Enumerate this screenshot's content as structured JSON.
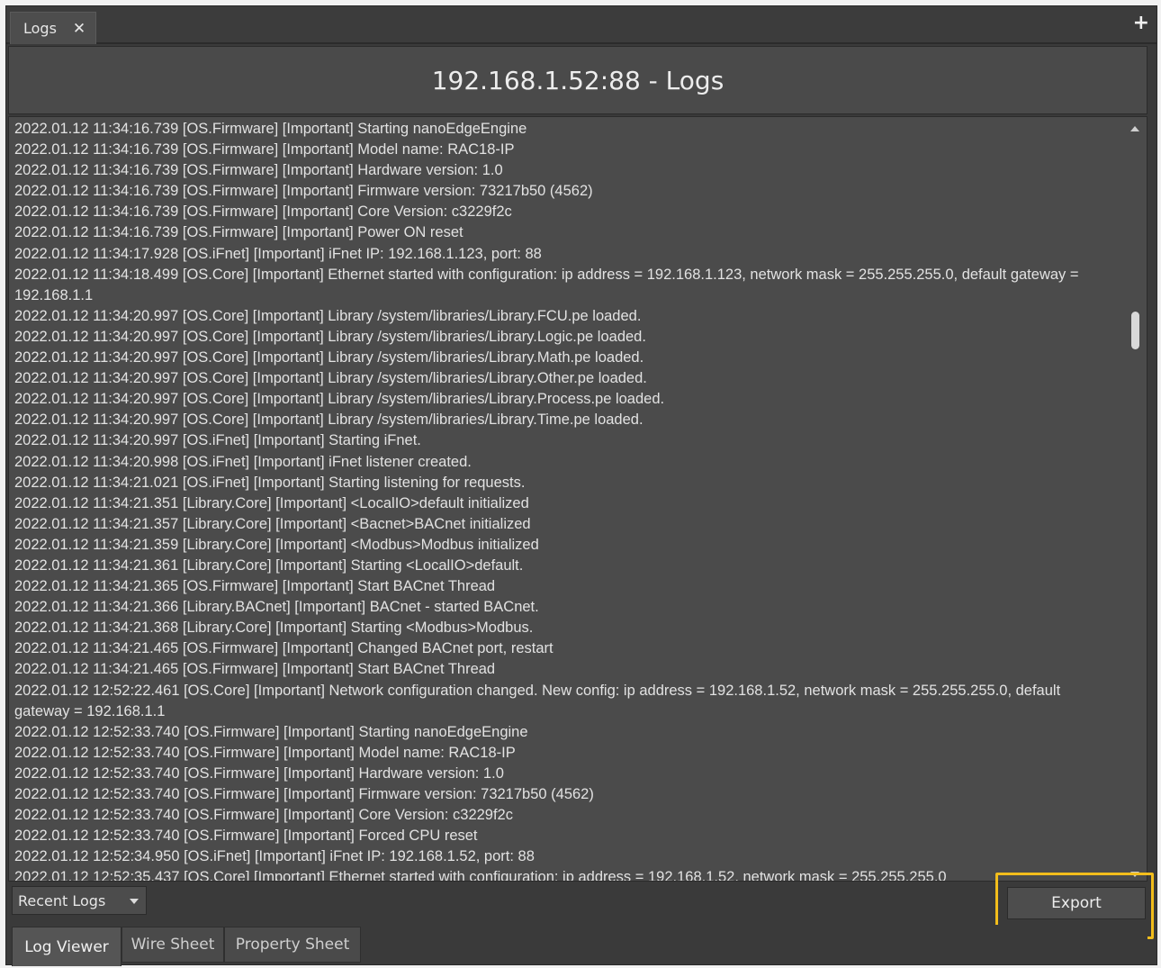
{
  "doc_tab": {
    "label": "Logs",
    "close_icon": "✕"
  },
  "add_tab_icon": "+",
  "header": {
    "title": "192.168.1.52:88 - Logs"
  },
  "log_lines": [
    "2022.01.12 11:34:16.739 [OS.Firmware] [Important] Starting nanoEdgeEngine",
    "2022.01.12 11:34:16.739 [OS.Firmware] [Important] Model name: RAC18-IP",
    "2022.01.12 11:34:16.739 [OS.Firmware] [Important] Hardware version: 1.0",
    "2022.01.12 11:34:16.739 [OS.Firmware] [Important] Firmware version: 73217b50 (4562)",
    "2022.01.12 11:34:16.739 [OS.Firmware] [Important] Core Version: c3229f2c",
    "2022.01.12 11:34:16.739 [OS.Firmware] [Important] Power ON reset",
    "2022.01.12 11:34:17.928 [OS.iFnet] [Important] iFnet IP: 192.168.1.123, port: 88",
    "2022.01.12 11:34:18.499 [OS.Core] [Important] Ethernet started with configuration: ip address = 192.168.1.123, network mask = 255.255.255.0, default gateway = 192.168.1.1",
    "2022.01.12 11:34:20.997 [OS.Core] [Important] Library /system/libraries/Library.FCU.pe loaded.",
    "2022.01.12 11:34:20.997 [OS.Core] [Important] Library /system/libraries/Library.Logic.pe loaded.",
    "2022.01.12 11:34:20.997 [OS.Core] [Important] Library /system/libraries/Library.Math.pe loaded.",
    "2022.01.12 11:34:20.997 [OS.Core] [Important] Library /system/libraries/Library.Other.pe loaded.",
    "2022.01.12 11:34:20.997 [OS.Core] [Important] Library /system/libraries/Library.Process.pe loaded.",
    "2022.01.12 11:34:20.997 [OS.Core] [Important] Library /system/libraries/Library.Time.pe loaded.",
    "2022.01.12 11:34:20.997 [OS.iFnet] [Important] Starting iFnet.",
    "2022.01.12 11:34:20.998 [OS.iFnet] [Important] iFnet listener created.",
    "2022.01.12 11:34:21.021 [OS.iFnet] [Important] Starting listening for requests.",
    "2022.01.12 11:34:21.351 [Library.Core] [Important] <LocalIO>default initialized",
    "2022.01.12 11:34:21.357 [Library.Core] [Important] <Bacnet>BACnet initialized",
    "2022.01.12 11:34:21.359 [Library.Core] [Important] <Modbus>Modbus initialized",
    "2022.01.12 11:34:21.361 [Library.Core] [Important] Starting <LocalIO>default.",
    "2022.01.12 11:34:21.365 [OS.Firmware] [Important] Start BACnet Thread",
    "2022.01.12 11:34:21.366 [Library.BACnet] [Important] BACnet - started BACnet.",
    "2022.01.12 11:34:21.368 [Library.Core] [Important] Starting <Modbus>Modbus.",
    "2022.01.12 11:34:21.465 [OS.Firmware] [Important] Changed BACnet port, restart",
    "2022.01.12 11:34:21.465 [OS.Firmware] [Important] Start BACnet Thread",
    "2022.01.12 12:52:22.461 [OS.Core] [Important] Network configuration changed. New config: ip address = 192.168.1.52, network mask = 255.255.255.0, default gateway = 192.168.1.1",
    "2022.01.12 12:52:33.740 [OS.Firmware] [Important] Starting nanoEdgeEngine",
    "2022.01.12 12:52:33.740 [OS.Firmware] [Important] Model name: RAC18-IP",
    "2022.01.12 12:52:33.740 [OS.Firmware] [Important] Hardware version: 1.0",
    "2022.01.12 12:52:33.740 [OS.Firmware] [Important] Firmware version: 73217b50 (4562)",
    "2022.01.12 12:52:33.740 [OS.Firmware] [Important] Core Version: c3229f2c",
    "2022.01.12 12:52:33.740 [OS.Firmware] [Important] Forced CPU reset",
    "2022.01.12 12:52:34.950 [OS.iFnet] [Important] iFnet IP: 192.168.1.52, port: 88",
    "2022.01.12 12:52:35.437 [OS.Core] [Important] Ethernet started with configuration: ip address = 192.168.1.52, network mask = 255.255.255.0"
  ],
  "filter": {
    "selected": "Recent Logs"
  },
  "export_label": "Export",
  "highlight_color": "#f2bd1c",
  "view_tabs": [
    {
      "label": "Log Viewer",
      "active": true
    },
    {
      "label": "Wire Sheet",
      "active": false
    },
    {
      "label": "Property Sheet",
      "active": false
    }
  ]
}
